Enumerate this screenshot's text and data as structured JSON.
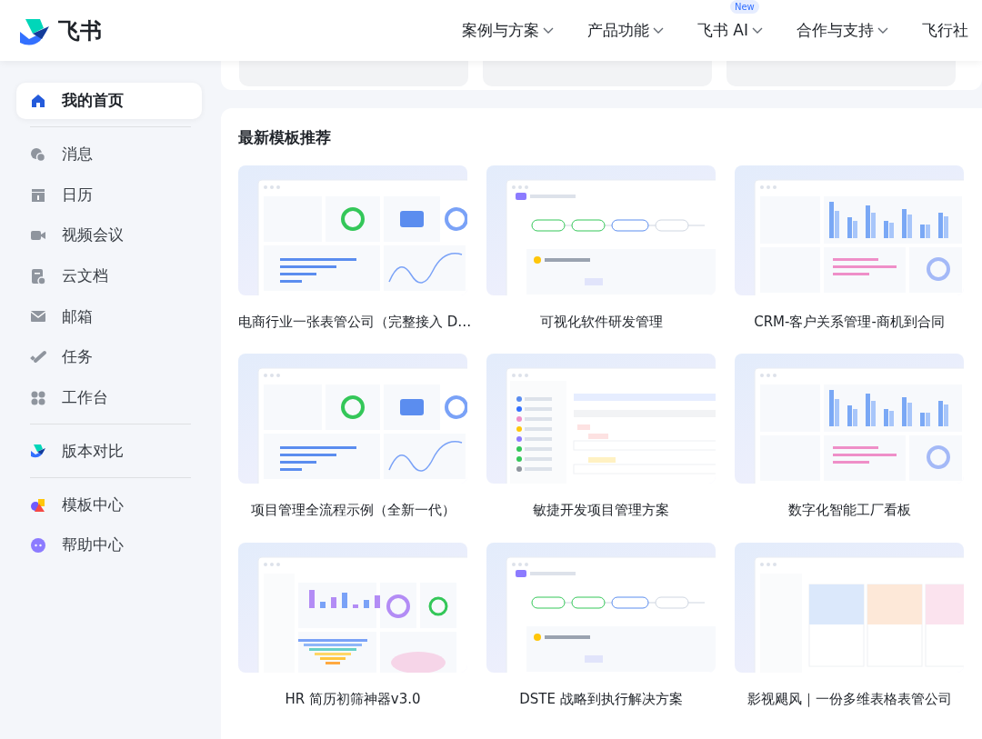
{
  "header": {
    "logo_text": "飞书",
    "nav": [
      {
        "label": "案例与方案",
        "dropdown": true
      },
      {
        "label": "产品功能",
        "dropdown": true
      },
      {
        "label": "飞书 AI",
        "dropdown": true,
        "badge": "New"
      },
      {
        "label": "合作与支持",
        "dropdown": true
      },
      {
        "label": "飞行社",
        "dropdown": false
      }
    ]
  },
  "sidebar": {
    "groups": [
      [
        {
          "label": "我的首页",
          "kind": "home",
          "selected": true
        }
      ],
      [
        {
          "label": "消息",
          "kind": "chat",
          "selected": false
        },
        {
          "label": "日历",
          "kind": "calendar",
          "selected": false
        },
        {
          "label": "视频会议",
          "kind": "video",
          "selected": false
        },
        {
          "label": "云文档",
          "kind": "doc",
          "selected": false
        },
        {
          "label": "邮箱",
          "kind": "mail",
          "selected": false
        },
        {
          "label": "任务",
          "kind": "task",
          "selected": false
        },
        {
          "label": "工作台",
          "kind": "apps",
          "selected": false
        }
      ],
      [
        {
          "label": "版本对比",
          "kind": "logo",
          "selected": false
        }
      ],
      [
        {
          "label": "模板中心",
          "kind": "shapes",
          "selected": false
        },
        {
          "label": "帮助中心",
          "kind": "help",
          "selected": false
        }
      ]
    ]
  },
  "section": {
    "title": "最新模板推荐",
    "templates": [
      {
        "title": "电商行业一张表管公司（完整接入 D…",
        "kind": "stats"
      },
      {
        "title": "可视化软件研发管理",
        "kind": "flow"
      },
      {
        "title": "CRM-客户关系管理-商机到合同",
        "kind": "bars"
      },
      {
        "title": "项目管理全流程示例（全新一代）",
        "kind": "stats"
      },
      {
        "title": "敏捷开发项目管理方案",
        "kind": "table"
      },
      {
        "title": "数字化智能工厂看板",
        "kind": "bars"
      },
      {
        "title": "HR 简历初筛神器v3.0",
        "kind": "funnel"
      },
      {
        "title": "DSTE 战略到执行解决方案",
        "kind": "flow"
      },
      {
        "title": "影视飓风｜一份多维表格表管公司",
        "kind": "gallery"
      }
    ]
  }
}
